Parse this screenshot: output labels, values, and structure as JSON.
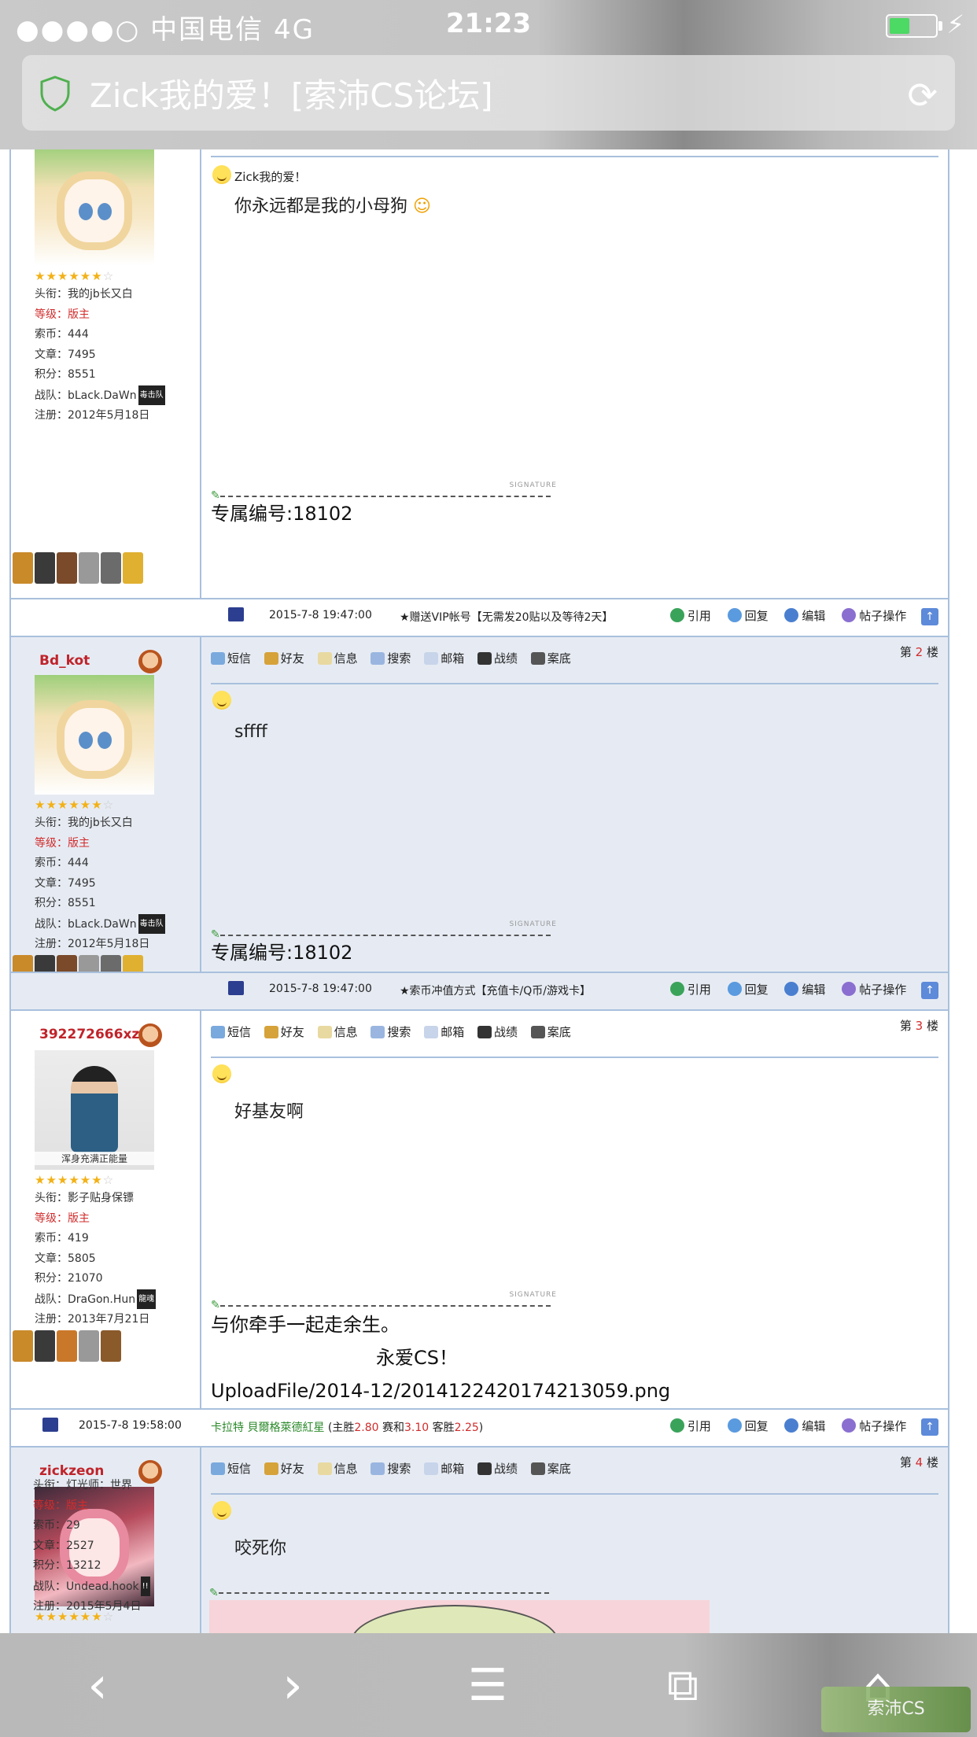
{
  "status_bar": {
    "carrier": "●●●●○ 中国电信   4G",
    "time": "21:23",
    "battery_level": 0.45
  },
  "browser": {
    "page_title": "Zick我的爱！[索沛CS论坛]"
  },
  "toolbar_labels": {
    "sms": "短信",
    "friend": "好友",
    "info": "信息",
    "search": "搜索",
    "mail": "邮箱",
    "stats": "战绩",
    "case": "案底"
  },
  "action_labels": {
    "quote": "引用",
    "reply": "回复",
    "edit": "编辑",
    "manage": "帖子操作"
  },
  "field_labels": {
    "title": "头衔：",
    "level": "等级：",
    "coins": "索币：",
    "articles": "文章：",
    "points": "积分：",
    "team": "战队：",
    "registered": "注册："
  },
  "signature_word": "SIGNATURE",
  "floor": {
    "prefix": "第",
    "suffix": "楼"
  },
  "posts": [
    {
      "rating_stars": 6,
      "user": {
        "title": "我的jb长又白",
        "level": "版主",
        "coins": "444",
        "articles": "7495",
        "points": "8551",
        "team": "bLack.DaWn",
        "team_badge": "毒击队",
        "registered": "2012年5月18日"
      },
      "post_title": "Zick我的爱！",
      "body": "你永远都是我的小母狗",
      "signature_lines": [
        "专属编号:18102"
      ],
      "footer": {
        "date": "2015-7-8 19:47:00",
        "note": "★赠送VIP帐号【无需发20贴以及等待2天】"
      }
    },
    {
      "username": "Bd_kot",
      "floor_number": "2",
      "rating_stars": 6,
      "user": {
        "title": "我的jb长又白",
        "level": "版主",
        "coins": "444",
        "articles": "7495",
        "points": "8551",
        "team": "bLack.DaWn",
        "team_badge": "毒击队",
        "registered": "2012年5月18日"
      },
      "body": "sffff",
      "signature_lines": [
        "专属编号:18102"
      ],
      "footer": {
        "date": "2015-7-8 19:47:00",
        "note": "★索币冲值方式【充值卡/Q币/游戏卡】"
      }
    },
    {
      "username": "392272666xzy",
      "floor_number": "3",
      "rating_stars": 6,
      "avatar_caption": "浑身充满正能量",
      "user": {
        "title": "影子贴身保镖",
        "level": "版主",
        "coins": "419",
        "articles": "5805",
        "points": "21070",
        "team": "DraGon.Hun",
        "team_badge": "龍魂",
        "registered": "2013年7月21日"
      },
      "body": "好基友啊",
      "signature_lines": [
        "与你牵手一起走余生。",
        "                    永爱CS！",
        "UploadFile/2014-12/20141224201742130​59.png"
      ],
      "footer": {
        "date": "2015-7-8 19:58:00",
        "note_team1": "卡拉特",
        "note_team2": "貝爾格萊德紅星",
        "note_rest1": " (主胜",
        "odds_home": "2.80",
        "note_rest2": " 赛和",
        "odds_draw": "3.10",
        "note_rest3": " 客胜",
        "odds_away": "2.25",
        "note_rest4": ")"
      }
    },
    {
      "username": "zickzeon",
      "floor_number": "4",
      "rating_stars": 6,
      "user": {
        "title": "灯光师：世界",
        "level": "版主",
        "coins": "29",
        "articles": "2527",
        "points": "13212",
        "team": "Undead.hook",
        "team_badge": "!!",
        "registered": "2015年5月4日"
      },
      "body": "咬死你"
    }
  ],
  "bottom_nav": {
    "back": "‹",
    "forward": "›",
    "menu": "☰",
    "tabs": "⧉",
    "home": "⌂"
  },
  "watermark": "索沛CS"
}
